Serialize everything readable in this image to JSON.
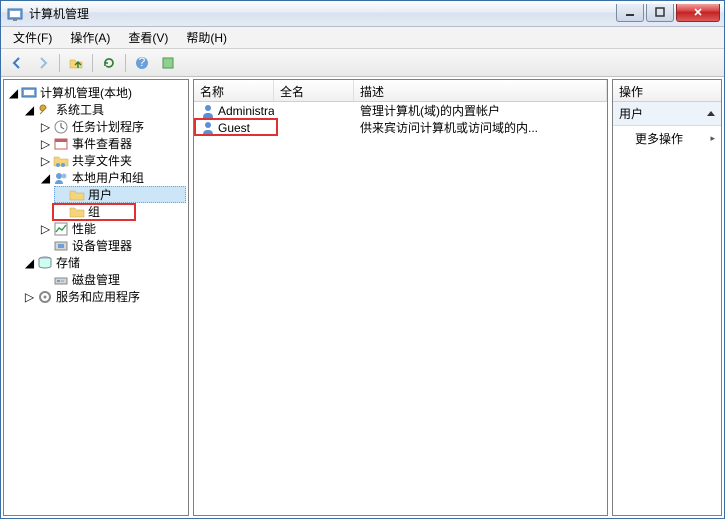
{
  "window": {
    "title": "计算机管理"
  },
  "menu": {
    "file": "文件(F)",
    "action": "操作(A)",
    "view": "查看(V)",
    "help": "帮助(H)"
  },
  "tree": {
    "root": "计算机管理(本地)",
    "system_tools": "系统工具",
    "task_scheduler": "任务计划程序",
    "event_viewer": "事件查看器",
    "shared_folders": "共享文件夹",
    "local_users_groups": "本地用户和组",
    "users": "用户",
    "groups": "组",
    "performance": "性能",
    "device_manager": "设备管理器",
    "storage": "存储",
    "disk_management": "磁盘管理",
    "services_apps": "服务和应用程序"
  },
  "list": {
    "columns": {
      "name": "名称",
      "fullname": "全名",
      "description": "描述"
    },
    "rows": [
      {
        "name": "Administrat...",
        "fullname": "",
        "description": "管理计算机(域)的内置帐户"
      },
      {
        "name": "Guest",
        "fullname": "",
        "description": "供来宾访问计算机或访问域的内..."
      }
    ]
  },
  "actions": {
    "title": "操作",
    "section": "用户",
    "more": "更多操作"
  }
}
